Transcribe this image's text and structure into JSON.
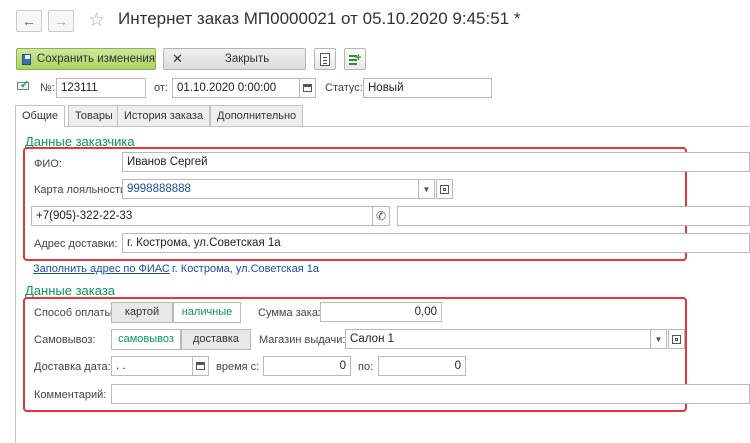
{
  "header": {
    "title": "Интернет заказ МП0000021 от 05.10.2020 9:45:51 *",
    "back_glyph": "←",
    "forward_glyph": "→",
    "star_glyph": "☆"
  },
  "toolbar": {
    "save_label": "Сохранить изменения",
    "close_label": "Закрыть"
  },
  "doc": {
    "number_label": "№:",
    "number_value": "123111",
    "date_label": "от:",
    "date_value": "01.10.2020  0:00:00",
    "status_label": "Статус:",
    "status_value": "Новый"
  },
  "tabs": [
    {
      "label": "Общие"
    },
    {
      "label": "Товары"
    },
    {
      "label": "История заказа"
    },
    {
      "label": "Дополнительно"
    }
  ],
  "customer": {
    "section_title": "Данные заказчика",
    "fio_label": "ФИО:",
    "fio_value": "Иванов Сергей",
    "card_label": "Карта лояльности:",
    "card_value": "9998888888",
    "phone_value": "+7(905)-322-22-33",
    "address_label": "Адрес доставки:",
    "address_value": "г. Кострома, ул.Советская 1а"
  },
  "fias": {
    "link_label": "Заполнить адрес по ФИАС",
    "address_value": "г. Кострома, ул.Советская 1а"
  },
  "order": {
    "section_title": "Данные заказа",
    "payment_label": "Способ оплаты:",
    "payment_options": [
      "картой",
      "наличные"
    ],
    "sum_label": "Сумма заказа:",
    "sum_value": "0,00",
    "pickup_label": "Самовывоз:",
    "pickup_options": [
      "самовывоз",
      "доставка"
    ],
    "store_label": "Магазин выдачи:",
    "store_value": "Салон 1",
    "delivery_date_label": "Доставка дата:",
    "delivery_date_value": " .  .",
    "time_from_label": "время с:",
    "time_from_value": "0",
    "time_to_label": "по:",
    "time_to_value": "0",
    "comment_label": "Комментарий:",
    "comment_value": ""
  },
  "colors": {
    "accent_green": "#0a9a5a",
    "highlight_red": "#e8343c",
    "link_blue": "#1a4fa8"
  }
}
